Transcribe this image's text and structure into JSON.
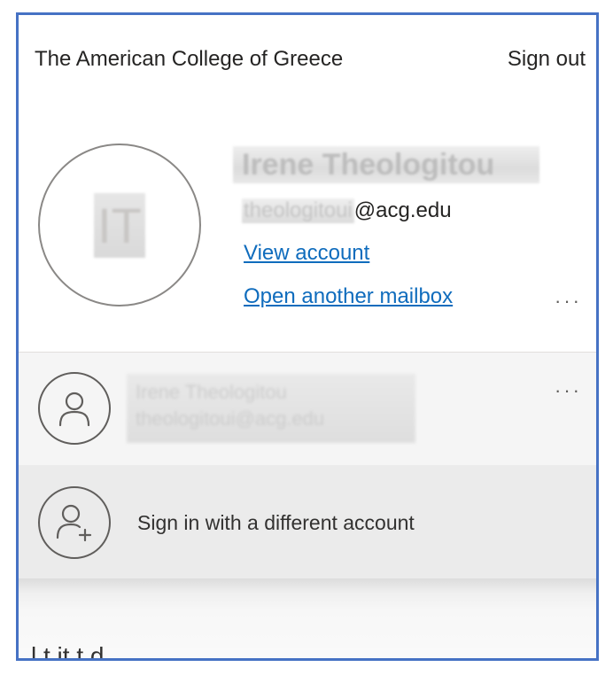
{
  "header": {
    "org_name": "The American College of Greece",
    "sign_out_label": "Sign out"
  },
  "profile": {
    "initials": "IT",
    "name": "Irene Theologitou",
    "email_user": "theologitoui",
    "email_domain": "@acg.edu",
    "view_account_label": "View account",
    "open_mailbox_label": "Open another mailbox",
    "more_label": "···"
  },
  "other_account": {
    "name": "Irene Theologitou",
    "email": "theologitoui@acg.edu",
    "more_label": "···"
  },
  "sign_in_different": {
    "label": "Sign in with a different account"
  },
  "background_peek": {
    "text": "l t  it  t  d"
  },
  "colors": {
    "frame_border": "#4672c4",
    "link": "#0f6cbd",
    "text": "#252423"
  }
}
